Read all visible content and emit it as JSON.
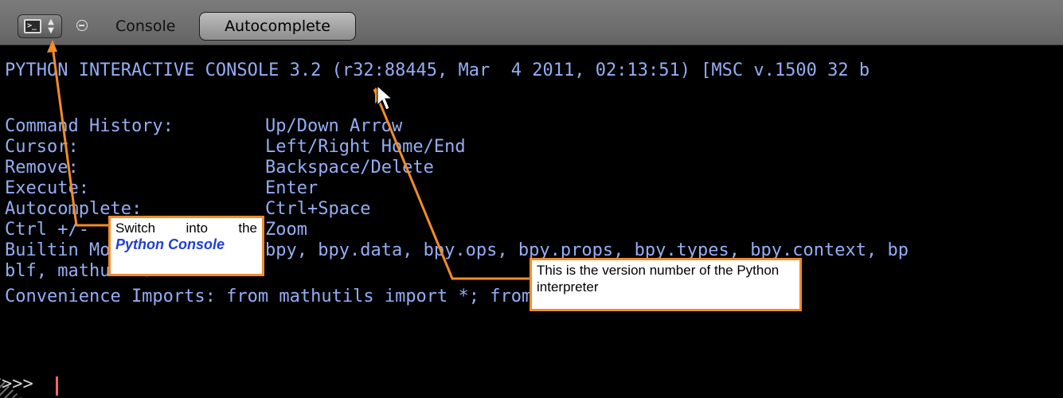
{
  "header": {
    "menu_console": "Console",
    "autocomplete_label": "Autocomplete"
  },
  "console": {
    "banner": "PYTHON INTERACTIVE CONSOLE 3.2 (r32:88445, Mar  4 2011, 02:13:51) [MSC v.1500 32 b",
    "rows": [
      {
        "key": "Command History:",
        "value": "Up/Down Arrow"
      },
      {
        "key": "Cursor:",
        "value": "Left/Right Home/End"
      },
      {
        "key": "Remove:",
        "value": "Backspace/Delete"
      },
      {
        "key": "Execute:",
        "value": "Enter"
      },
      {
        "key": "Autocomplete:",
        "value": "Ctrl+Space"
      },
      {
        "key": "Ctrl +/-",
        "value": "Zoom"
      },
      {
        "key": "Builtin Modules:",
        "value": "bpy, bpy.data, bpy.ops, bpy.props, bpy.types, bpy.context, bp"
      }
    ],
    "wrap_line": "blf, mathutils",
    "imports_line": "Convenience Imports: from mathutils import *; from math import *",
    "prompt": ">>>"
  },
  "callouts": {
    "switch_line1_a": "Switch",
    "switch_line1_b": "into",
    "switch_line1_c": "the",
    "switch_line2": "Python Console",
    "version_text": "This is the version number of the Python interpreter"
  },
  "colors": {
    "console_text": "#94aef5",
    "callout_border": "#f28c28",
    "cursor": "#ff6464"
  }
}
